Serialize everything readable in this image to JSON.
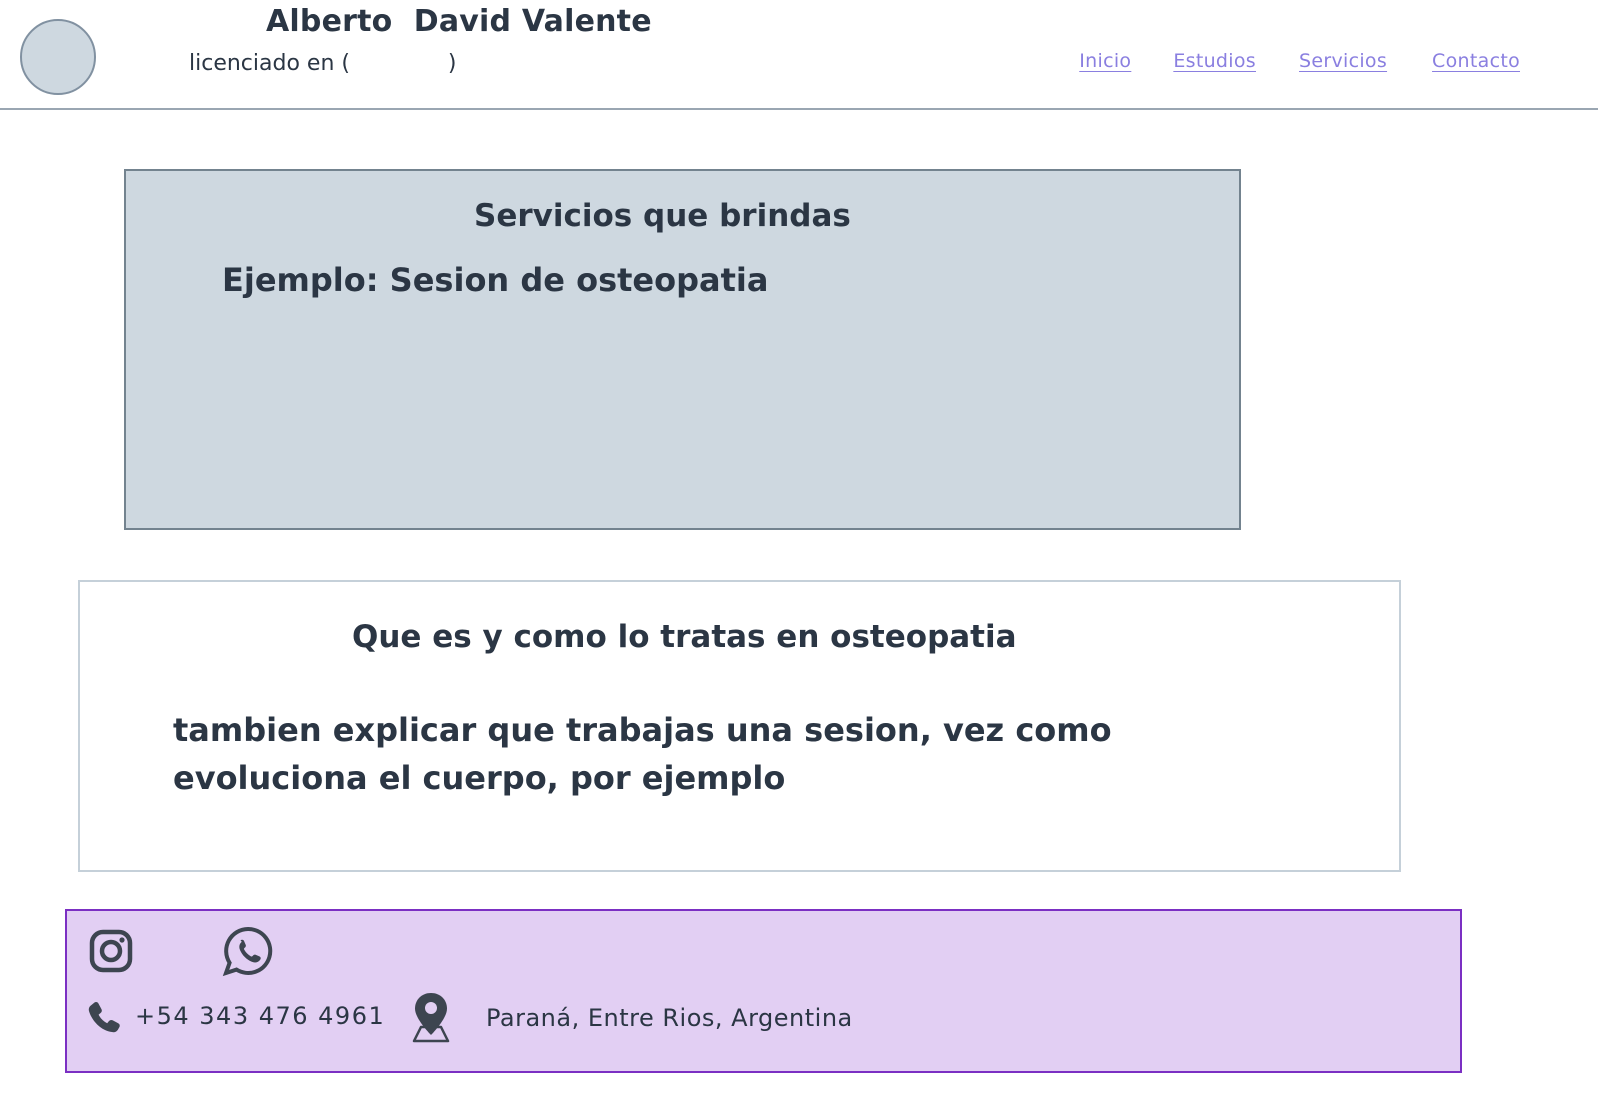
{
  "header": {
    "name": "Alberto  David Valente",
    "subtitle": "licenciado en (              )",
    "nav": [
      {
        "label": "Inicio"
      },
      {
        "label": "Estudios"
      },
      {
        "label": "Servicios"
      },
      {
        "label": "Contacto"
      }
    ],
    "nav_color": "#8a7fe0"
  },
  "services": {
    "title": "Servicios que brindas",
    "example": "Ejemplo: Sesion de osteopatia",
    "background": "#ced8e0"
  },
  "explanation": {
    "title": "Que es y como lo tratas en osteopatia",
    "body": "tambien explicar que trabajas una sesion, vez como evoluciona el cuerpo, por ejemplo"
  },
  "footer": {
    "background": "#e2cff3",
    "border": "#7b2fc3",
    "icons": [
      "instagram-icon",
      "whatsapp-icon",
      "phone-icon",
      "location-pin-icon"
    ],
    "phone": "+54 343 476 4961",
    "location": "Paraná, Entre Rios, Argentina"
  }
}
